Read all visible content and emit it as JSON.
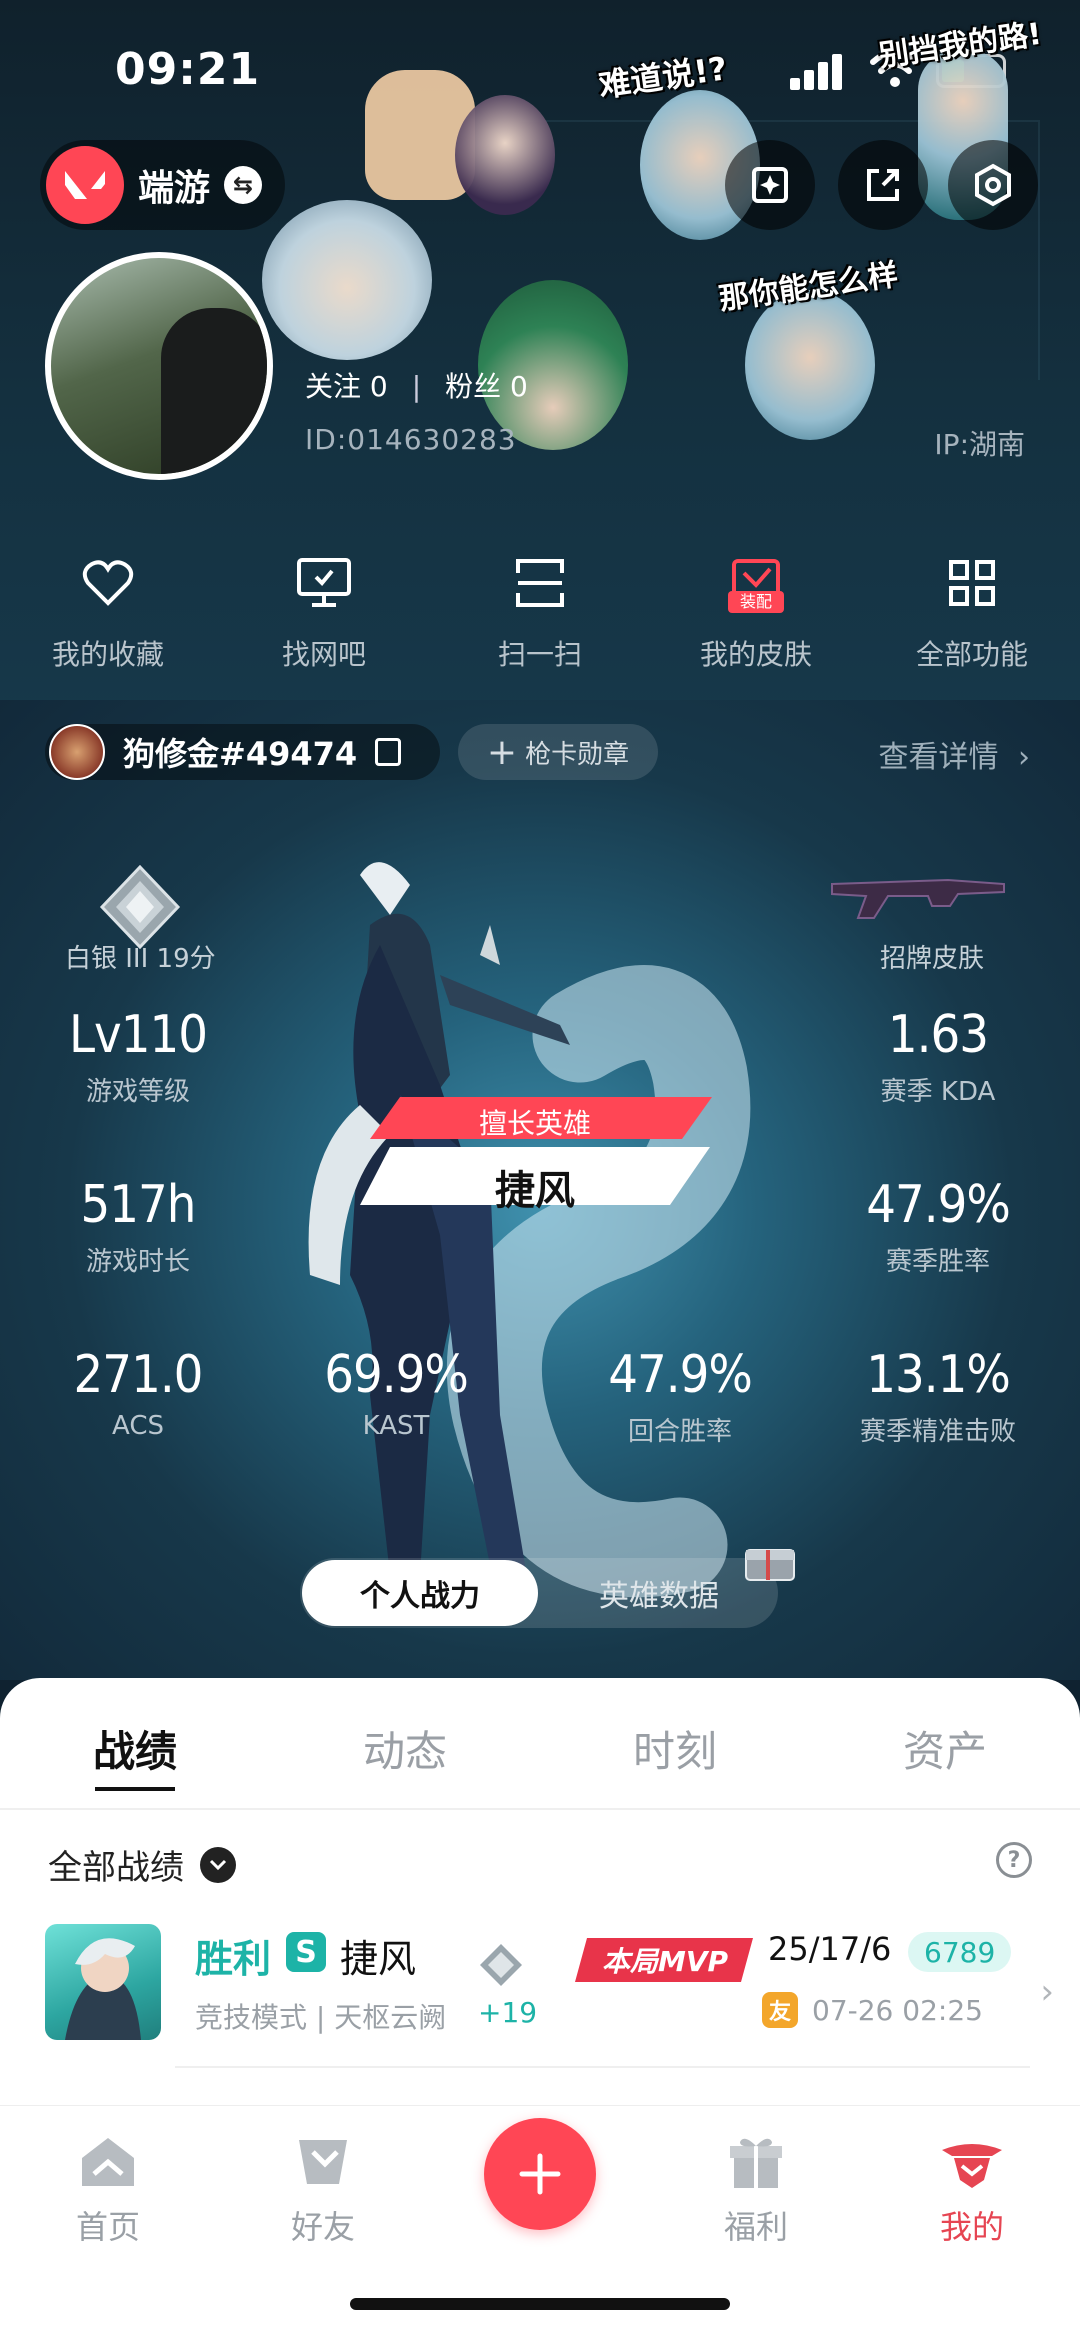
{
  "status_bar": {
    "time": "09:21"
  },
  "app": {
    "name": "端游"
  },
  "stickers": {
    "s1": "难道说!?",
    "s2": "别挡我的路!",
    "s3": "那你能怎么样"
  },
  "profile": {
    "follow_label": "关注 0",
    "fans_label": "粉丝 0",
    "id": "ID:014630283",
    "ip": "IP:湖南"
  },
  "quick_actions": [
    {
      "label": "我的收藏",
      "icon": "heart-icon"
    },
    {
      "label": "找网吧",
      "icon": "monitor-icon"
    },
    {
      "label": "扫一扫",
      "icon": "scan-icon"
    },
    {
      "label": "我的皮肤",
      "icon": "skin-icon",
      "badge": "装配"
    },
    {
      "label": "全部功能",
      "icon": "grid-icon"
    }
  ],
  "player": {
    "name": "狗修金#49474",
    "badge_label": "枪卡勋章",
    "details_label": "查看详情"
  },
  "rank": {
    "label": "白银 III 19分"
  },
  "skin": {
    "label": "招牌皮肤"
  },
  "stats": {
    "level": {
      "value": "Lv110",
      "label": "游戏等级"
    },
    "kda": {
      "value": "1.63",
      "label": "赛季 KDA"
    },
    "hours": {
      "value": "517h",
      "label": "游戏时长"
    },
    "winrate": {
      "value": "47.9%",
      "label": "赛季胜率"
    },
    "acs": {
      "value": "271.0",
      "label": "ACS"
    },
    "kast": {
      "value": "69.9%",
      "label": "KAST"
    },
    "round_win": {
      "value": "47.9%",
      "label": "回合胜率"
    },
    "first_kill": {
      "value": "13.1%",
      "label": "赛季精准击败"
    }
  },
  "hero": {
    "tag": "擅长英雄",
    "name": "捷风"
  },
  "toggle": {
    "active": "个人战力",
    "inactive": "英雄数据"
  },
  "tabs": [
    "战绩",
    "动态",
    "时刻",
    "资产"
  ],
  "filter": {
    "label": "全部战绩"
  },
  "match": {
    "result": "胜利",
    "agent_initial": "S",
    "agent": "捷风",
    "mode": "竞技模式 | 天枢云阙",
    "rr": "+19",
    "mvp": "本局MVP",
    "kda": "25/17/6",
    "score": "6789",
    "friend": "友",
    "date": "07-26 02:25"
  },
  "nav": [
    {
      "label": "首页",
      "icon": "home-icon"
    },
    {
      "label": "好友",
      "icon": "friends-icon"
    },
    {
      "label": "福利",
      "icon": "gift-icon"
    },
    {
      "label": "我的",
      "icon": "profile-icon"
    }
  ],
  "colors": {
    "accent": "#ff4655",
    "win": "#1db3a7",
    "sheet": "#ffffff"
  }
}
